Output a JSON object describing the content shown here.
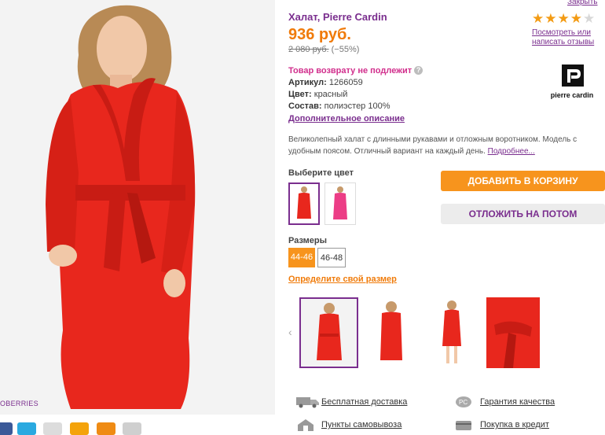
{
  "product": {
    "title": "Халат, Pierre Cardin",
    "price": "936 руб.",
    "old_price": "2 080 руб.",
    "discount": "(−55%)",
    "no_return": "Товар возврату не подлежит",
    "article_label": "Артикул:",
    "article_value": "1266059",
    "color_label": "Цвет:",
    "color_value": "красный",
    "material_label": "Состав:",
    "material_value": "полиэстер 100%",
    "more_description": "Дополнительное описание",
    "description_line1": "Великолепный халат с длинными рукавами и отложным воротником. Модель с",
    "description_line2": "удобным поясом. Отличный вариант на каждый день.",
    "details_link": "Подробнее...",
    "brand_tag": "OBERRIES"
  },
  "rating": {
    "filled": 4,
    "total": 5,
    "reviews_link_line1": "Посмотреть или",
    "reviews_link_line2": "написать отзывы",
    "close_link": "Закрыть"
  },
  "brand_logo_text": "pierre cardin",
  "colors": {
    "label": "Выберите цвет",
    "options": [
      "red",
      "pink"
    ]
  },
  "buttons": {
    "add_to_cart": "ДОБАВИТЬ В КОРЗИНУ",
    "save_for_later": "ОТЛОЖИТЬ НА ПОТОМ"
  },
  "sizes": {
    "label": "Размеры",
    "options": [
      "44-46",
      "46-48"
    ],
    "selected": "44-46",
    "find_size": "Определите свой размер"
  },
  "services": {
    "free_delivery": "Бесплатная доставка",
    "pickup_points": "Пункты самовывоза",
    "quality": "Гарантия качества",
    "credit": "Покупка в кредит"
  },
  "colors_theme": {
    "accent": "#7a2e8e",
    "orange": "#f7941d",
    "product_red": "#e8271d"
  }
}
